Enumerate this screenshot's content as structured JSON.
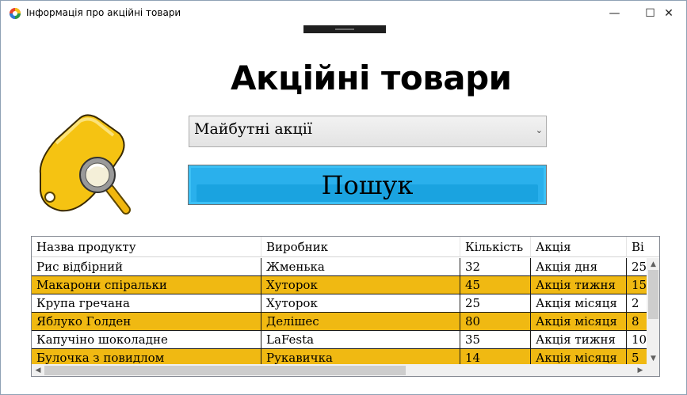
{
  "window": {
    "title": "Інформація про акційні товари",
    "minimize": "—",
    "maximize": "☐",
    "close": "✕"
  },
  "heading": "Акційні товари",
  "filter": {
    "selected": "Майбутні акції",
    "arrow": "⌄"
  },
  "search_button": "Пошук",
  "grid": {
    "columns": [
      "Назва продукту",
      "Виробник",
      "Кількість",
      "Акція",
      "Ві"
    ],
    "rows": [
      [
        "Рис відбірний",
        "Жменька",
        "32",
        "Акція дня",
        "25"
      ],
      [
        "Макарони спіральки",
        "Хуторок",
        "45",
        "Акція тижня",
        "15"
      ],
      [
        "Крупа гречана",
        "Хуторок",
        "25",
        "Акція місяця",
        "2"
      ],
      [
        "Яблуко  Голден",
        "Делішес",
        "80",
        "Акція місяця",
        "8"
      ],
      [
        "Капучіно шоколадне",
        "LaFesta",
        "35",
        "Акція тижня",
        "10"
      ],
      [
        "Булочка з повидлом",
        "Рукавичка",
        "14",
        "Акція місяця",
        "5"
      ]
    ],
    "alt_row_color": "#f0b912",
    "vscroll_up": "▲",
    "vscroll_down": "▼",
    "hscroll_left": "◀",
    "hscroll_right": "▶"
  }
}
